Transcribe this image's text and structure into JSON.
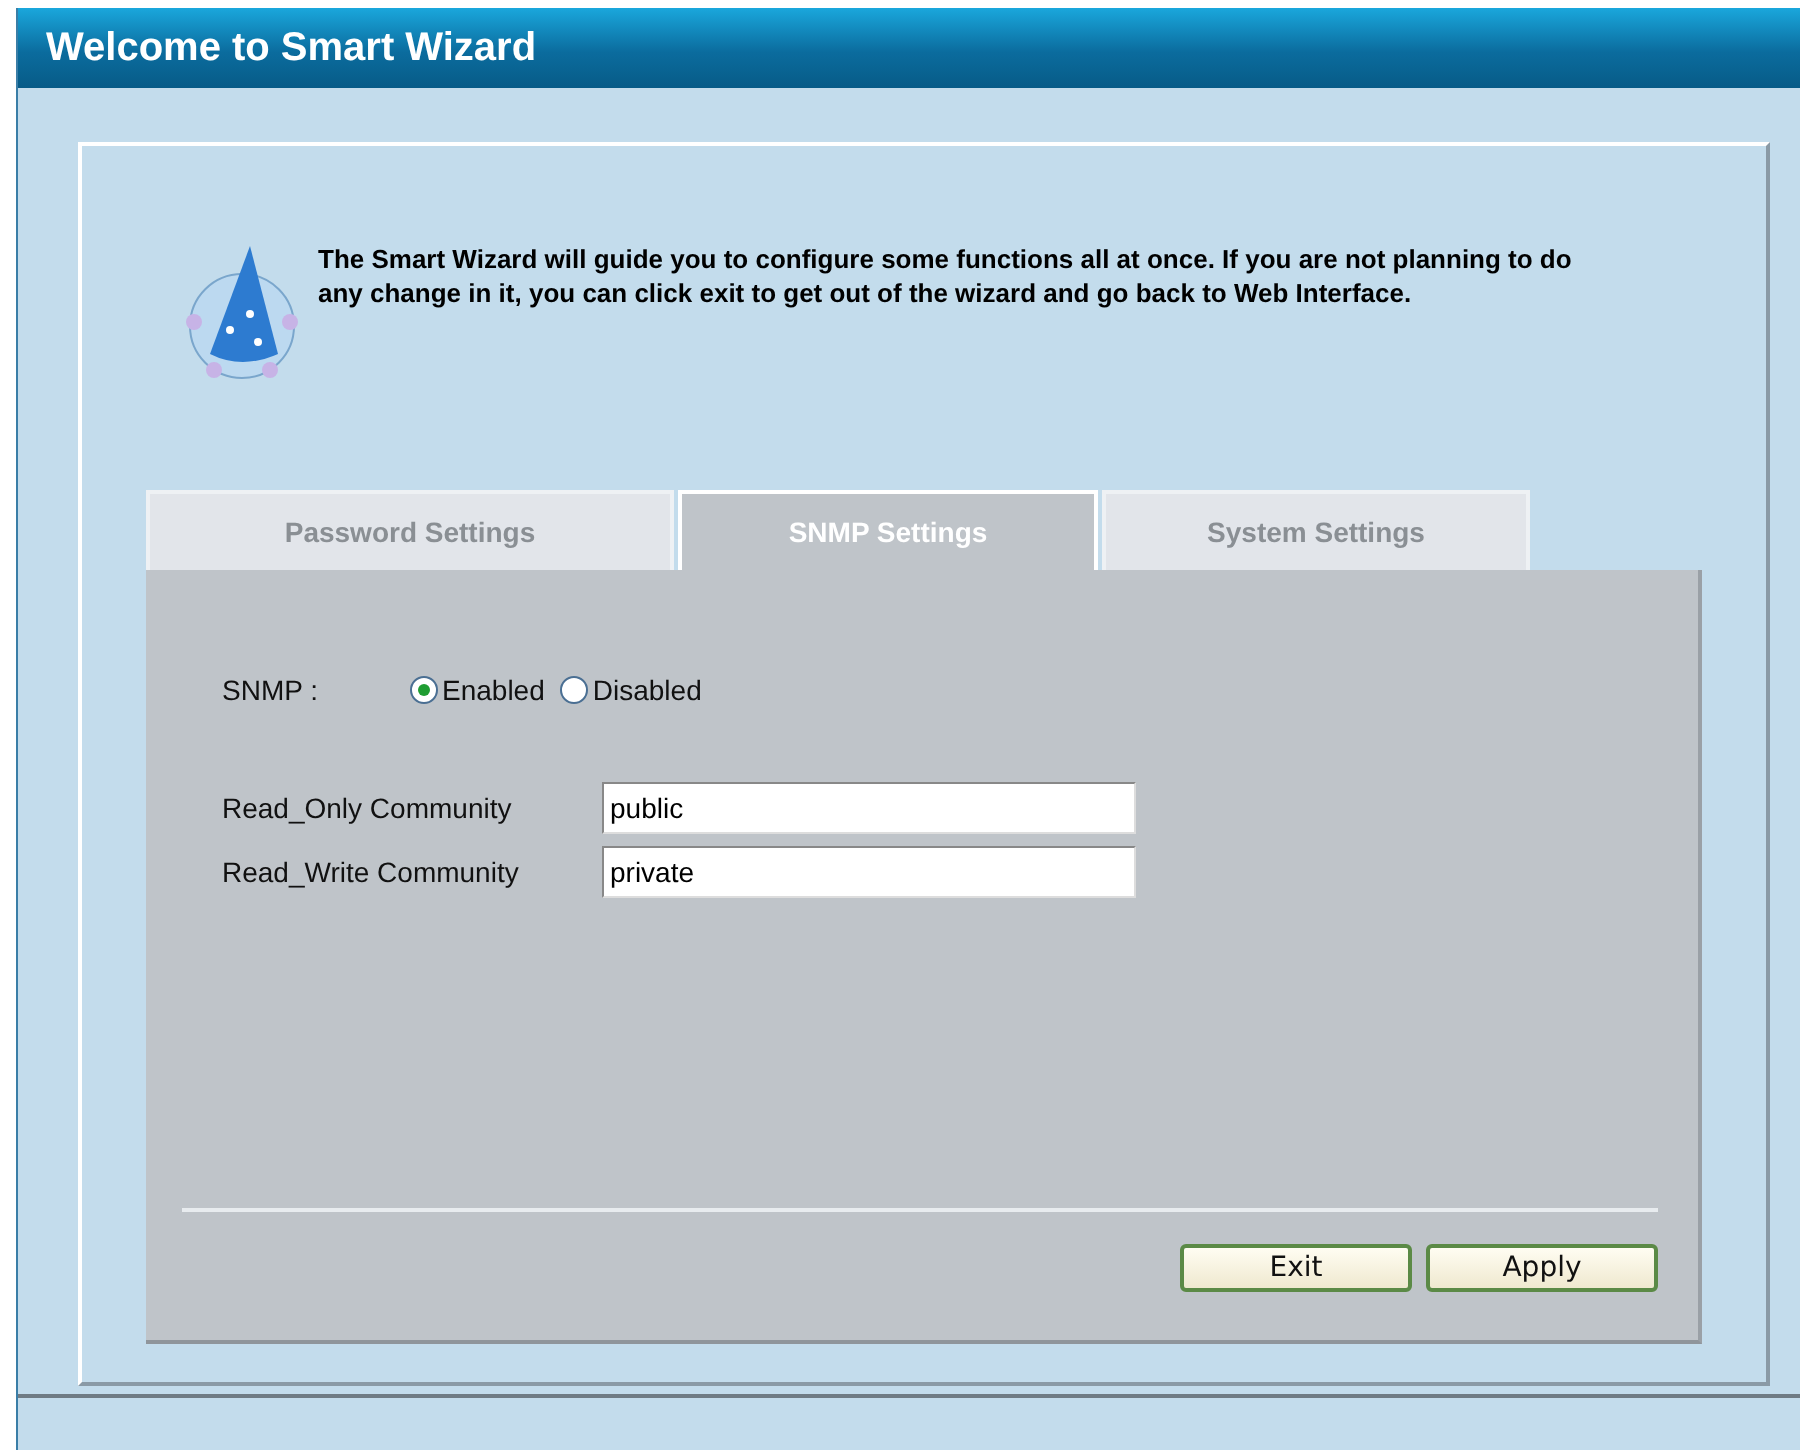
{
  "window": {
    "title": "Welcome to Smart Wizard"
  },
  "intro": "The Smart Wizard will guide you to configure some functions all at once. If you are not planning to do any change in it, you can click exit to get out of the wizard and go back to Web Interface.",
  "tabs": [
    {
      "label": "Password Settings",
      "selected": false
    },
    {
      "label": "SNMP Settings",
      "selected": true
    },
    {
      "label": "System Settings",
      "selected": false
    }
  ],
  "snmp": {
    "label": "SNMP :",
    "options": [
      {
        "label": "Enabled",
        "selected": true
      },
      {
        "label": "Disabled",
        "selected": false
      }
    ]
  },
  "fields": [
    {
      "label": "Read_Only Community",
      "value": "public"
    },
    {
      "label": "Read_Write Community",
      "value": "private"
    }
  ],
  "buttons": [
    "Exit",
    "Apply"
  ]
}
